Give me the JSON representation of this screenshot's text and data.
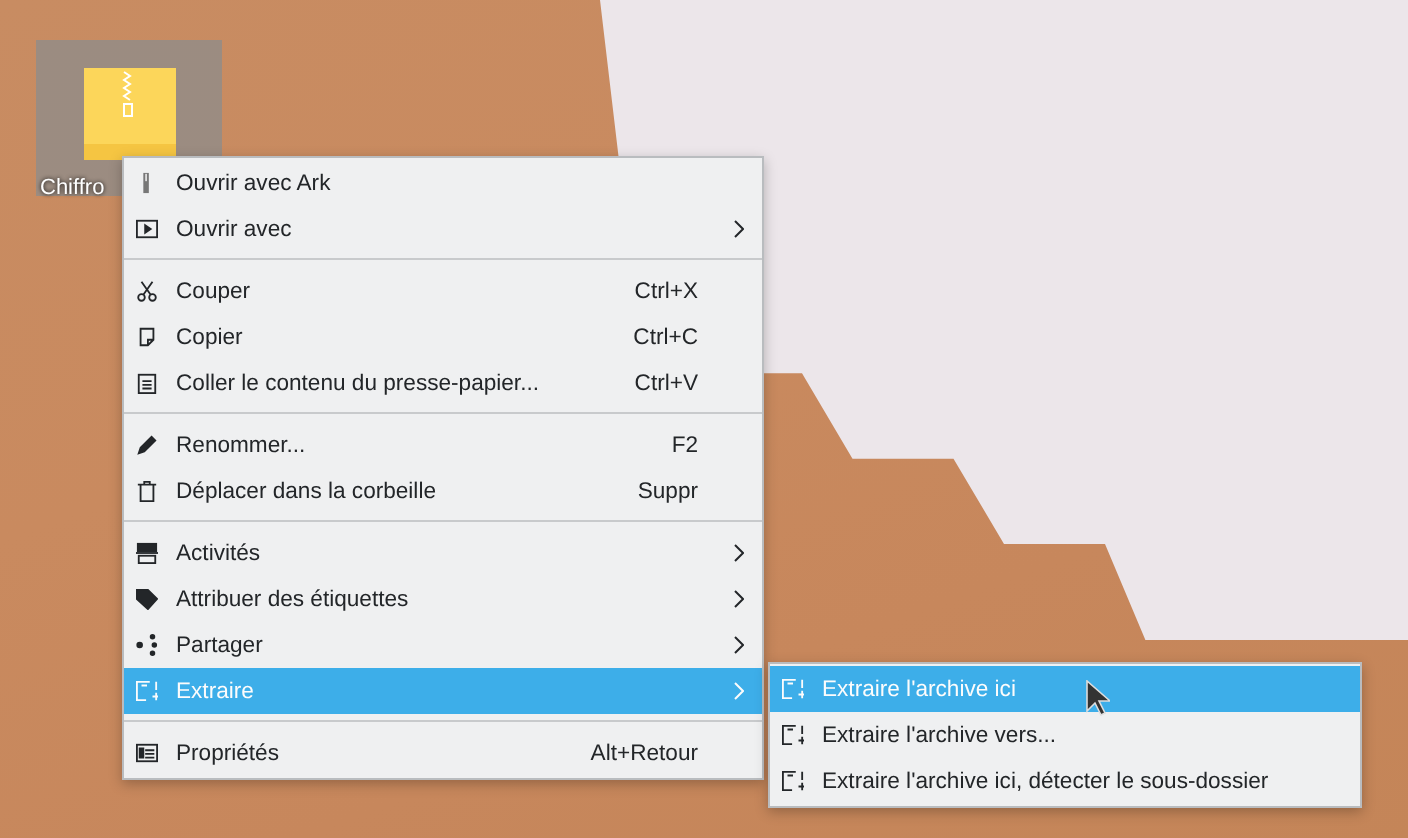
{
  "desktop_icon": {
    "label": "Chiffro",
    "selected": true
  },
  "context_menu": {
    "items": [
      {
        "kind": "item",
        "label": "Ouvrir avec Ark",
        "submenu": false,
        "selected": false
      },
      {
        "kind": "item",
        "label": "Ouvrir avec",
        "submenu": true,
        "selected": false
      },
      {
        "kind": "separator"
      },
      {
        "kind": "item",
        "label": "Couper",
        "shortcut": "Ctrl+X",
        "submenu": false,
        "selected": false
      },
      {
        "kind": "item",
        "label": "Copier",
        "shortcut": "Ctrl+C",
        "submenu": false,
        "selected": false
      },
      {
        "kind": "item",
        "label": "Coller le contenu du presse-papier...",
        "shortcut": "Ctrl+V",
        "submenu": false,
        "selected": false
      },
      {
        "kind": "separator"
      },
      {
        "kind": "item",
        "label": "Renommer...",
        "shortcut": "F2",
        "submenu": false,
        "selected": false
      },
      {
        "kind": "item",
        "label": "Déplacer dans la corbeille",
        "shortcut": "Suppr",
        "submenu": false,
        "selected": false
      },
      {
        "kind": "separator"
      },
      {
        "kind": "item",
        "label": "Activités",
        "submenu": true,
        "selected": false
      },
      {
        "kind": "item",
        "label": "Attribuer des étiquettes",
        "submenu": true,
        "selected": false
      },
      {
        "kind": "item",
        "label": "Partager",
        "submenu": true,
        "selected": false
      },
      {
        "kind": "item",
        "label": "Extraire",
        "submenu": true,
        "selected": true
      },
      {
        "kind": "separator"
      },
      {
        "kind": "item",
        "label": "Propriétés",
        "shortcut": "Alt+Retour",
        "submenu": false,
        "selected": false
      }
    ]
  },
  "submenu": {
    "items": [
      {
        "label": "Extraire l'archive ici",
        "selected": true
      },
      {
        "label": "Extraire l'archive vers...",
        "selected": false
      },
      {
        "label": "Extraire l'archive ici, détecter le sous-dossier",
        "selected": false
      }
    ]
  }
}
